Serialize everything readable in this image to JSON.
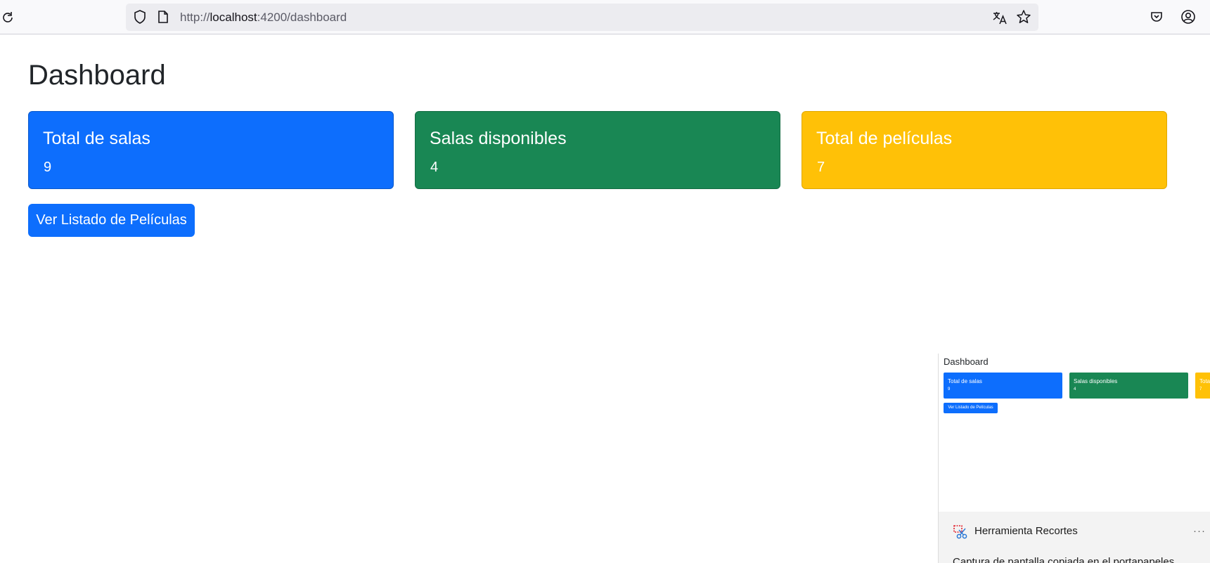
{
  "browser": {
    "url_prefix": "http://",
    "url_host": "localhost",
    "url_path": ":4200/dashboard"
  },
  "page": {
    "title": "Dashboard",
    "cards": [
      {
        "title": "Total de salas",
        "value": "9",
        "color": "#0d6efd"
      },
      {
        "title": "Salas disponibles",
        "value": "4",
        "color": "#198754"
      },
      {
        "title": "Total de películas",
        "value": "7",
        "color": "#ffc107"
      }
    ],
    "button_label": "Ver Listado de Películas"
  },
  "notification": {
    "thumb": {
      "title": "Dashboard",
      "cards": [
        {
          "title": "Total de salas",
          "value": "9"
        },
        {
          "title": "Salas disponibles",
          "value": "4"
        },
        {
          "title": "Tota",
          "value": "7"
        }
      ],
      "button_label": "Ver Listado de Películas"
    },
    "app_name": "Herramienta Recortes",
    "more": "···",
    "body": "Captura de pantalla copiada en el portapapeles"
  }
}
